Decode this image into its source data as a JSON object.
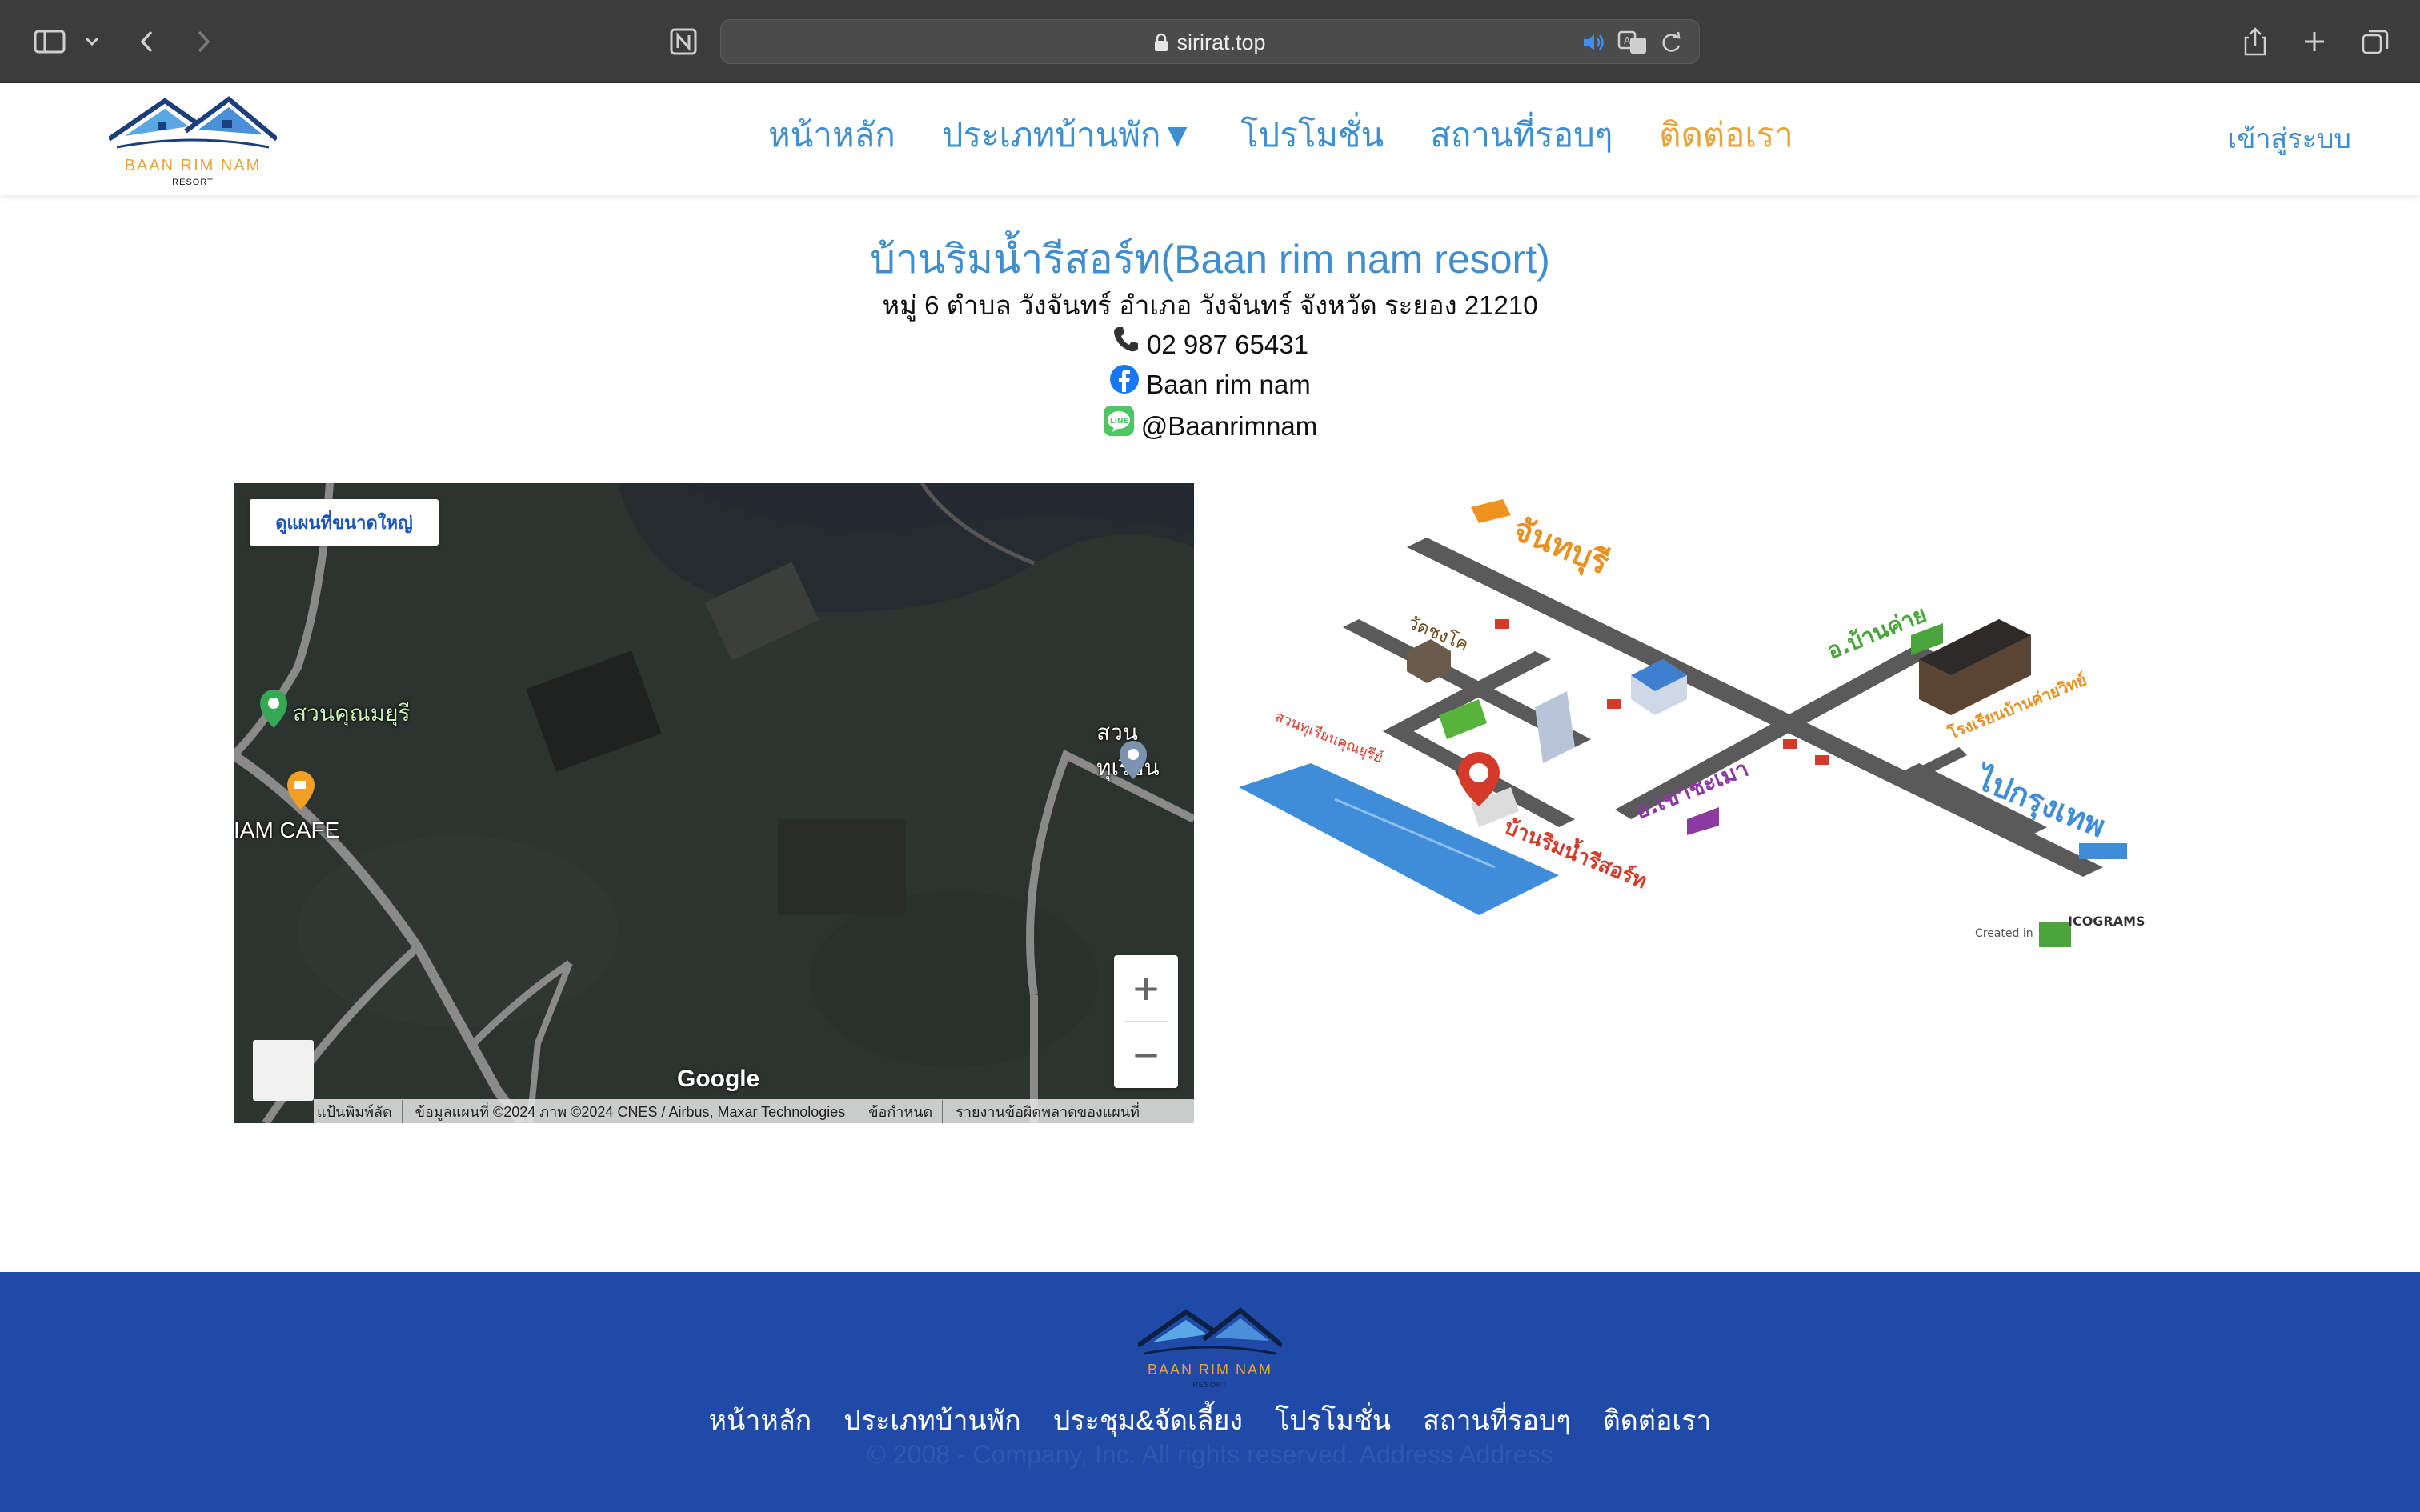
{
  "browser": {
    "url": "sirirat.top"
  },
  "logo": {
    "title": "BAAN RIM NAM",
    "subtitle": "RESORT"
  },
  "nav": {
    "home": "หน้าหลัก",
    "room_types": "ประเภทบ้านพัก▼",
    "promotions": "โปรโมชั่น",
    "nearby": "สถานที่รอบๆ",
    "contact": "ติดต่อเรา",
    "login": "เข้าสู่ระบบ"
  },
  "contact": {
    "name": "บ้านริมน้ำรีสอร์ท(Baan rim nam resort)",
    "address": "หมู่ 6 ตำบล วังจันทร์ อำเภอ วังจันทร์ จังหวัด ระยอง 21210",
    "phone": "02 987 65431",
    "facebook": "Baan rim nam",
    "line": "@Baanrimnam"
  },
  "map": {
    "view_larger": "ดูแผนที่ขนาดใหญ่",
    "place_1": "สวนคุณมยุรี",
    "place_2": "IAM CAFE",
    "place_3": "สวนทุเรียน",
    "brand": "Google",
    "footer": {
      "shortcuts": "แป้นพิมพ์ลัด",
      "data": "ข้อมูลแผนที่ ©2024 ภาพ ©2024 CNES / Airbus, Maxar Technologies",
      "terms": "ข้อกำหนด",
      "report": "รายงานข้อผิดพลาดของแผนที่"
    }
  },
  "illustration": {
    "chanthaburi": "จันทบุรี",
    "wat": "วัดชงโค",
    "ban_khai": "อ.บ้านค่าย",
    "school": "โรงเรียนบ้านค่ายวิทย์",
    "durian": "สวนทุเรียนคุณยุรีย์",
    "khao_chamao": "อ.เขาชะเมา",
    "resort": "บ้านริมน้ำรีสอร์ท",
    "bangkok": "ไปกรุงเทพ",
    "created_in": "Created in",
    "icograms": "ICOGRAMS"
  },
  "footer": {
    "links": [
      "หน้าหลัก",
      "ประเภทบ้านพัก",
      "ประชุม&จัดเลี้ยง",
      "โปรโมชั่น",
      "สถานที่รอบๆ",
      "ติดต่อเรา"
    ],
    "copyright": "© 2008 - Company, Inc. All rights reserved. Address Address"
  }
}
